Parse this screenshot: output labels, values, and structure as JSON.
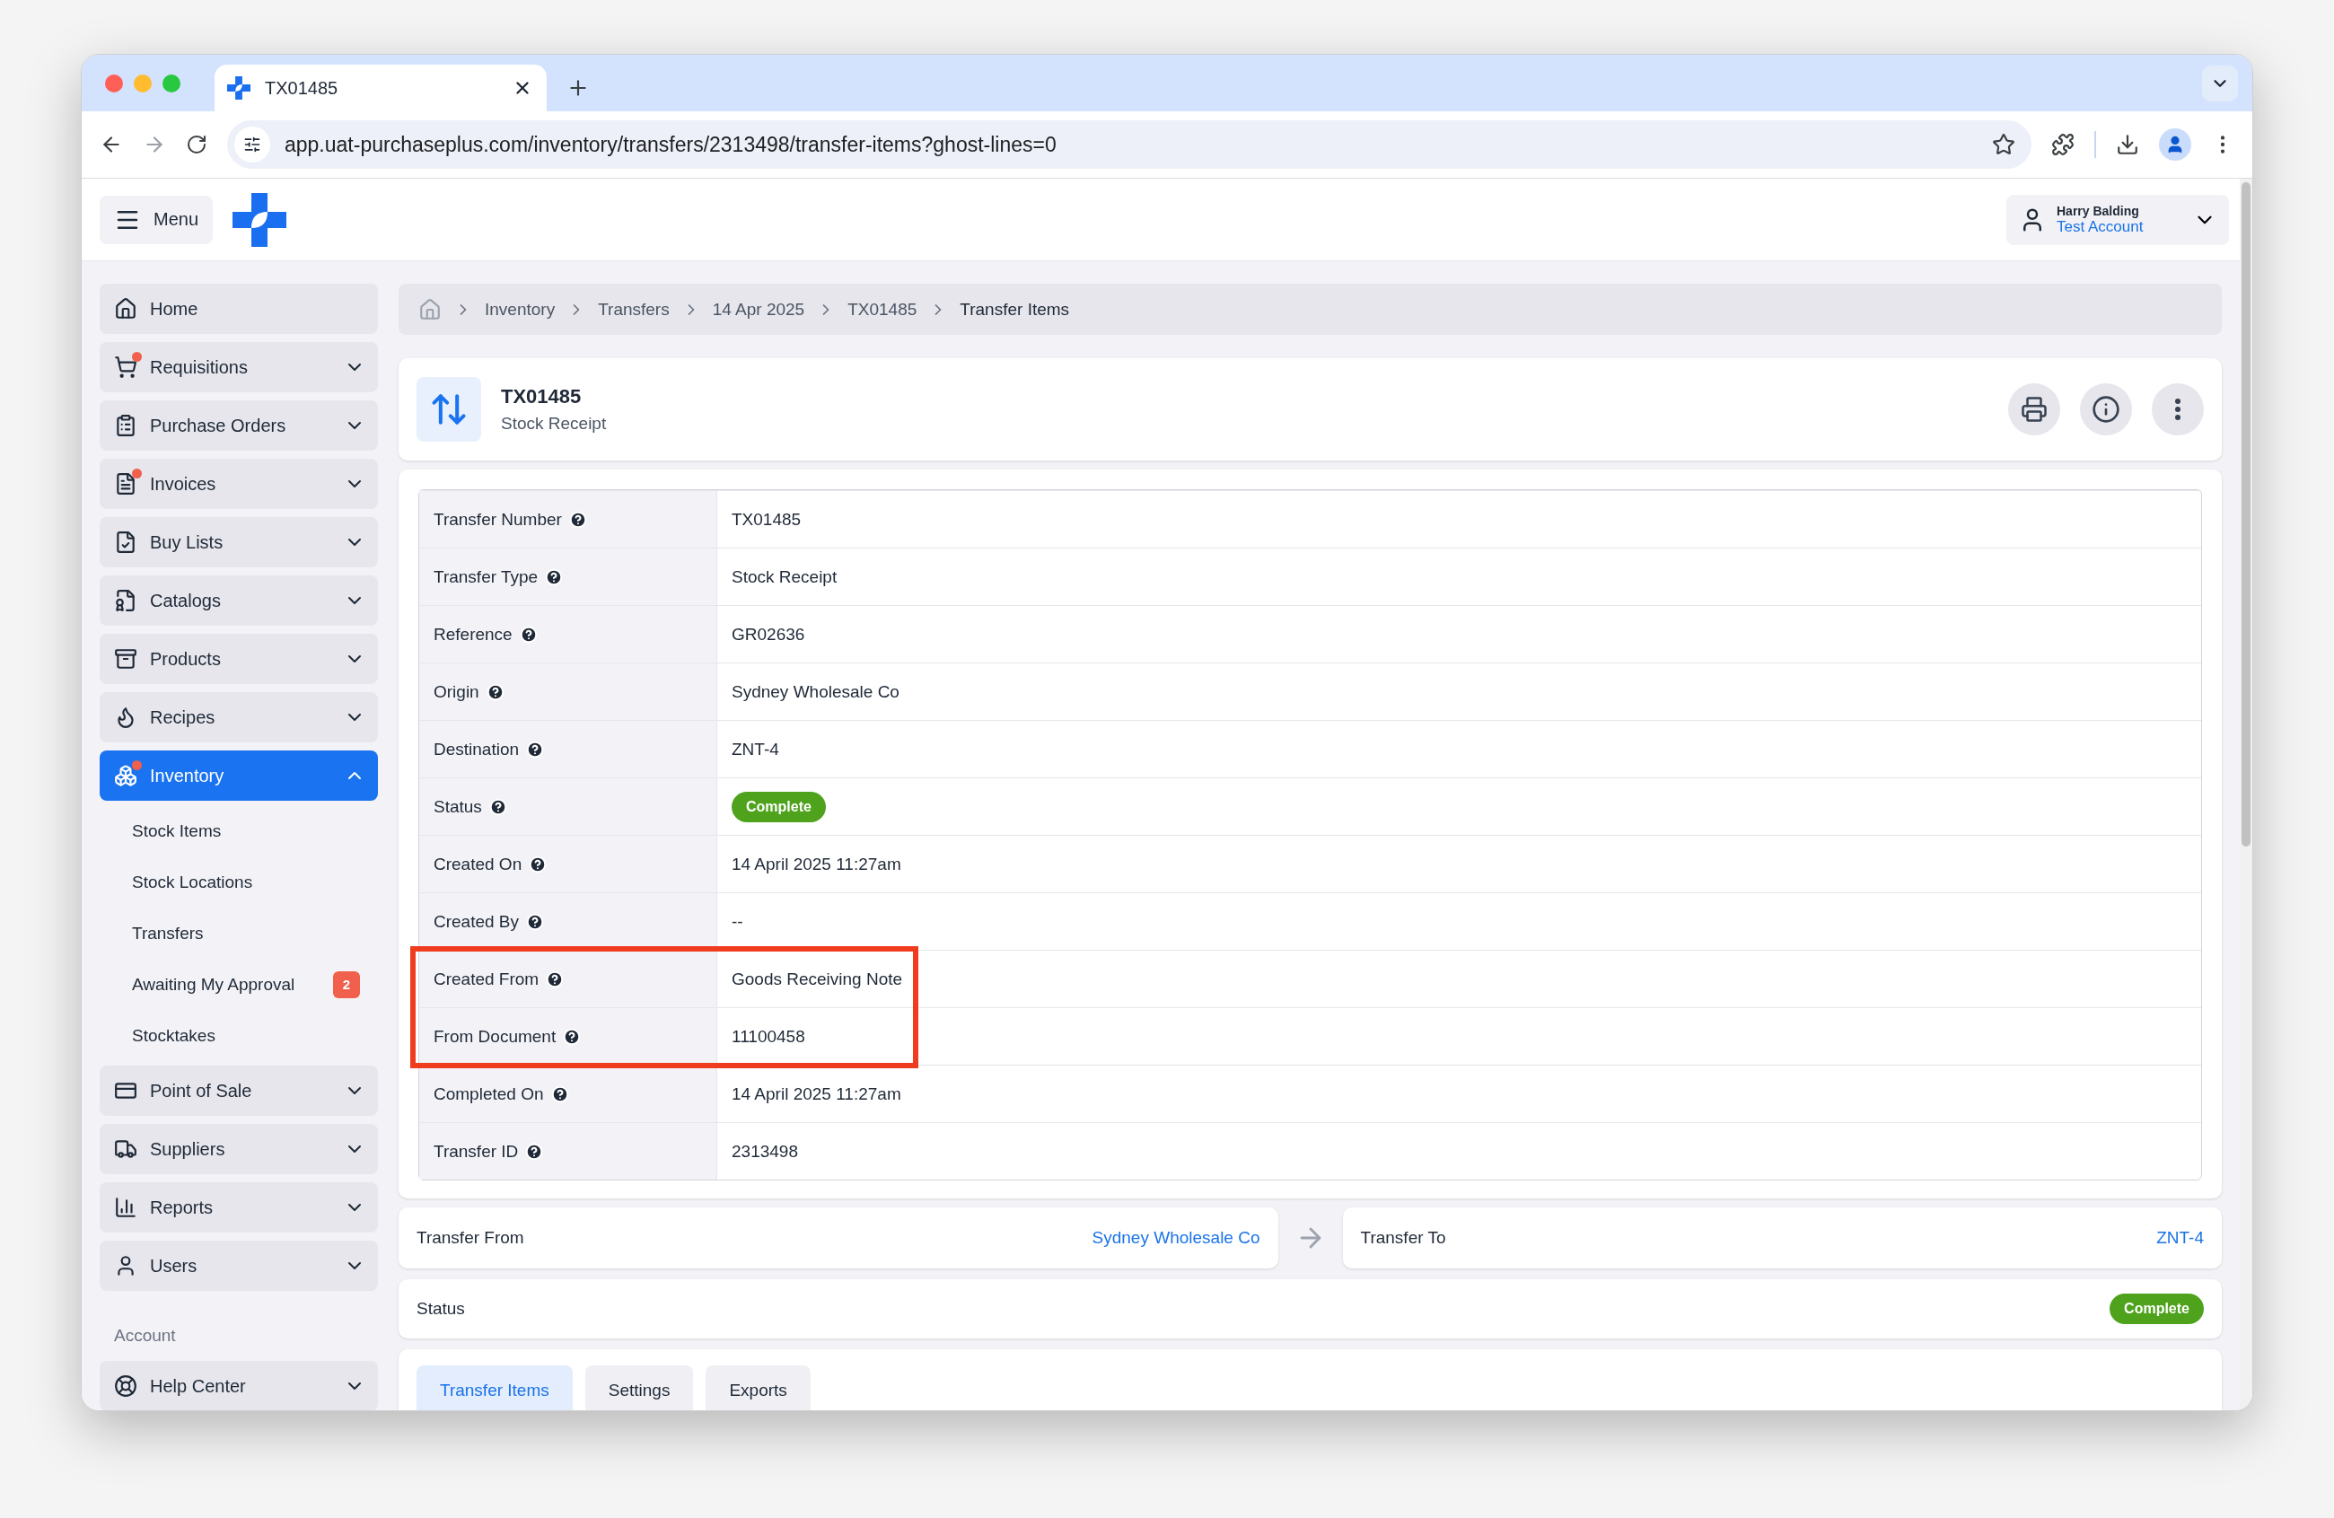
{
  "browser": {
    "tab_title": "TX01485",
    "url": "app.uat-purchaseplus.com/inventory/transfers/2313498/transfer-items?ghost-lines=0"
  },
  "header": {
    "menu_label": "Menu",
    "user": {
      "name": "Harry Balding",
      "account": "Test Account"
    }
  },
  "sidebar": {
    "items": [
      {
        "label": "Home",
        "notification": false,
        "expandable": false,
        "selected": false
      },
      {
        "label": "Requisitions",
        "notification": true,
        "expandable": true,
        "expanded": false,
        "selected": false
      },
      {
        "label": "Purchase Orders",
        "notification": false,
        "expandable": true,
        "expanded": false,
        "selected": false
      },
      {
        "label": "Invoices",
        "notification": true,
        "expandable": true,
        "expanded": false,
        "selected": false
      },
      {
        "label": "Buy Lists",
        "notification": false,
        "expandable": true,
        "expanded": false,
        "selected": false
      },
      {
        "label": "Catalogs",
        "notification": false,
        "expandable": true,
        "expanded": false,
        "selected": false
      },
      {
        "label": "Products",
        "notification": false,
        "expandable": true,
        "expanded": false,
        "selected": false
      },
      {
        "label": "Recipes",
        "notification": false,
        "expandable": true,
        "expanded": false,
        "selected": false
      },
      {
        "label": "Inventory",
        "notification": true,
        "expandable": true,
        "expanded": true,
        "selected": true,
        "children": [
          {
            "label": "Stock Items"
          },
          {
            "label": "Stock Locations"
          },
          {
            "label": "Transfers"
          },
          {
            "label": "Awaiting My Approval",
            "badge": "2"
          },
          {
            "label": "Stocktakes"
          }
        ]
      },
      {
        "label": "Point of Sale",
        "notification": false,
        "expandable": true,
        "expanded": false,
        "selected": false
      },
      {
        "label": "Suppliers",
        "notification": false,
        "expandable": true,
        "expanded": false,
        "selected": false
      },
      {
        "label": "Reports",
        "notification": false,
        "expandable": true,
        "expanded": false,
        "selected": false
      },
      {
        "label": "Users",
        "notification": false,
        "expandable": true,
        "expanded": false,
        "selected": false
      }
    ],
    "section_label": "Account",
    "account_items": [
      {
        "label": "Help Center",
        "notification": false,
        "expandable": true,
        "expanded": false,
        "selected": false
      }
    ]
  },
  "breadcrumb": [
    "Inventory",
    "Transfers",
    "14 Apr 2025",
    "TX01485",
    "Transfer Items"
  ],
  "transfer": {
    "number": "TX01485",
    "type": "Stock Receipt"
  },
  "details": [
    {
      "label": "Transfer Number",
      "value": "TX01485",
      "kind": "text",
      "highlighted": false
    },
    {
      "label": "Transfer Type",
      "value": "Stock Receipt",
      "kind": "text",
      "highlighted": false
    },
    {
      "label": "Reference",
      "value": "GR02636",
      "kind": "text",
      "highlighted": false
    },
    {
      "label": "Origin",
      "value": "Sydney Wholesale Co",
      "kind": "text",
      "highlighted": false
    },
    {
      "label": "Destination",
      "value": "ZNT-4",
      "kind": "text",
      "highlighted": false
    },
    {
      "label": "Status",
      "value": "Complete",
      "kind": "badge",
      "highlighted": false
    },
    {
      "label": "Created On",
      "value": "14 April 2025 11:27am",
      "kind": "text",
      "highlighted": false
    },
    {
      "label": "Created By",
      "value": "--",
      "kind": "text",
      "highlighted": false
    },
    {
      "label": "Created From",
      "value": "Goods Receiving Note",
      "kind": "text",
      "highlighted": true
    },
    {
      "label": "From Document",
      "value": "11100458",
      "kind": "text",
      "highlighted": true
    },
    {
      "label": "Completed On",
      "value": "14 April 2025 11:27am",
      "kind": "text",
      "highlighted": false
    },
    {
      "label": "Transfer ID",
      "value": "2313498",
      "kind": "text",
      "highlighted": false
    }
  ],
  "route": {
    "from_label": "Transfer From",
    "from": "Sydney Wholesale Co",
    "to_label": "Transfer To",
    "to": "ZNT-4"
  },
  "status": {
    "label": "Status",
    "value": "Complete"
  },
  "tabs": [
    {
      "label": "Transfer Items",
      "selected": true
    },
    {
      "label": "Settings",
      "selected": false
    },
    {
      "label": "Exports",
      "selected": false
    }
  ]
}
